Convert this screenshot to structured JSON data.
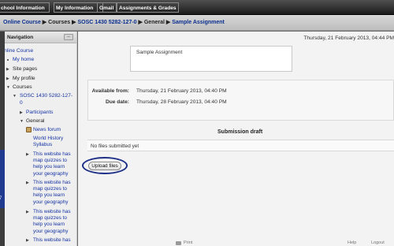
{
  "topbar": {
    "tabs": [
      {
        "label": "chool Information"
      },
      {
        "label": "My Information"
      },
      {
        "label": "Gmail"
      },
      {
        "label": "Assignments & Grades"
      }
    ]
  },
  "breadcrumb": {
    "items": [
      {
        "label": "Online Course"
      },
      {
        "label": "Courses"
      },
      {
        "label": "SOSC 1430 5282-127-0"
      },
      {
        "label": "General"
      },
      {
        "label": "Sample Assignment"
      }
    ],
    "separator": "▶"
  },
  "navigation": {
    "title": "Navigation",
    "dock_label": "–",
    "root": "Online Course",
    "items": {
      "my_home": "My home",
      "site_pages": "Site pages",
      "my_profile": "My profile",
      "courses": "Courses",
      "course_code_line1": "SOSC 1430 5282-127-",
      "course_code_line2": "0",
      "participants": "Participants",
      "general": "General",
      "news_forum": "News forum",
      "world_history_line1": "World History",
      "world_history_line2": "Syllabus",
      "geo_line1": "This website has",
      "geo_line2": "map quizzes to",
      "geo_line3": "help you learn",
      "geo_line4": "your geography"
    }
  },
  "main": {
    "datetime": "Thursday, 21 February 2013, 04:44 PM",
    "intro": "Sample Assignment",
    "allow_from_label": "Available from:",
    "allow_from_value": "Thursday, 21 February 2013, 04:40 PM",
    "due_label": "Due date:",
    "due_value": "Thursday, 28 February 2013, 04:40 PM",
    "submission_title": "Submission draft",
    "no_files": "No files submitted yet",
    "upload_button": "Upload files"
  },
  "footer": {
    "print": "Print",
    "help": "Help",
    "logout": "Logout"
  },
  "left_strip_fragment": "7"
}
